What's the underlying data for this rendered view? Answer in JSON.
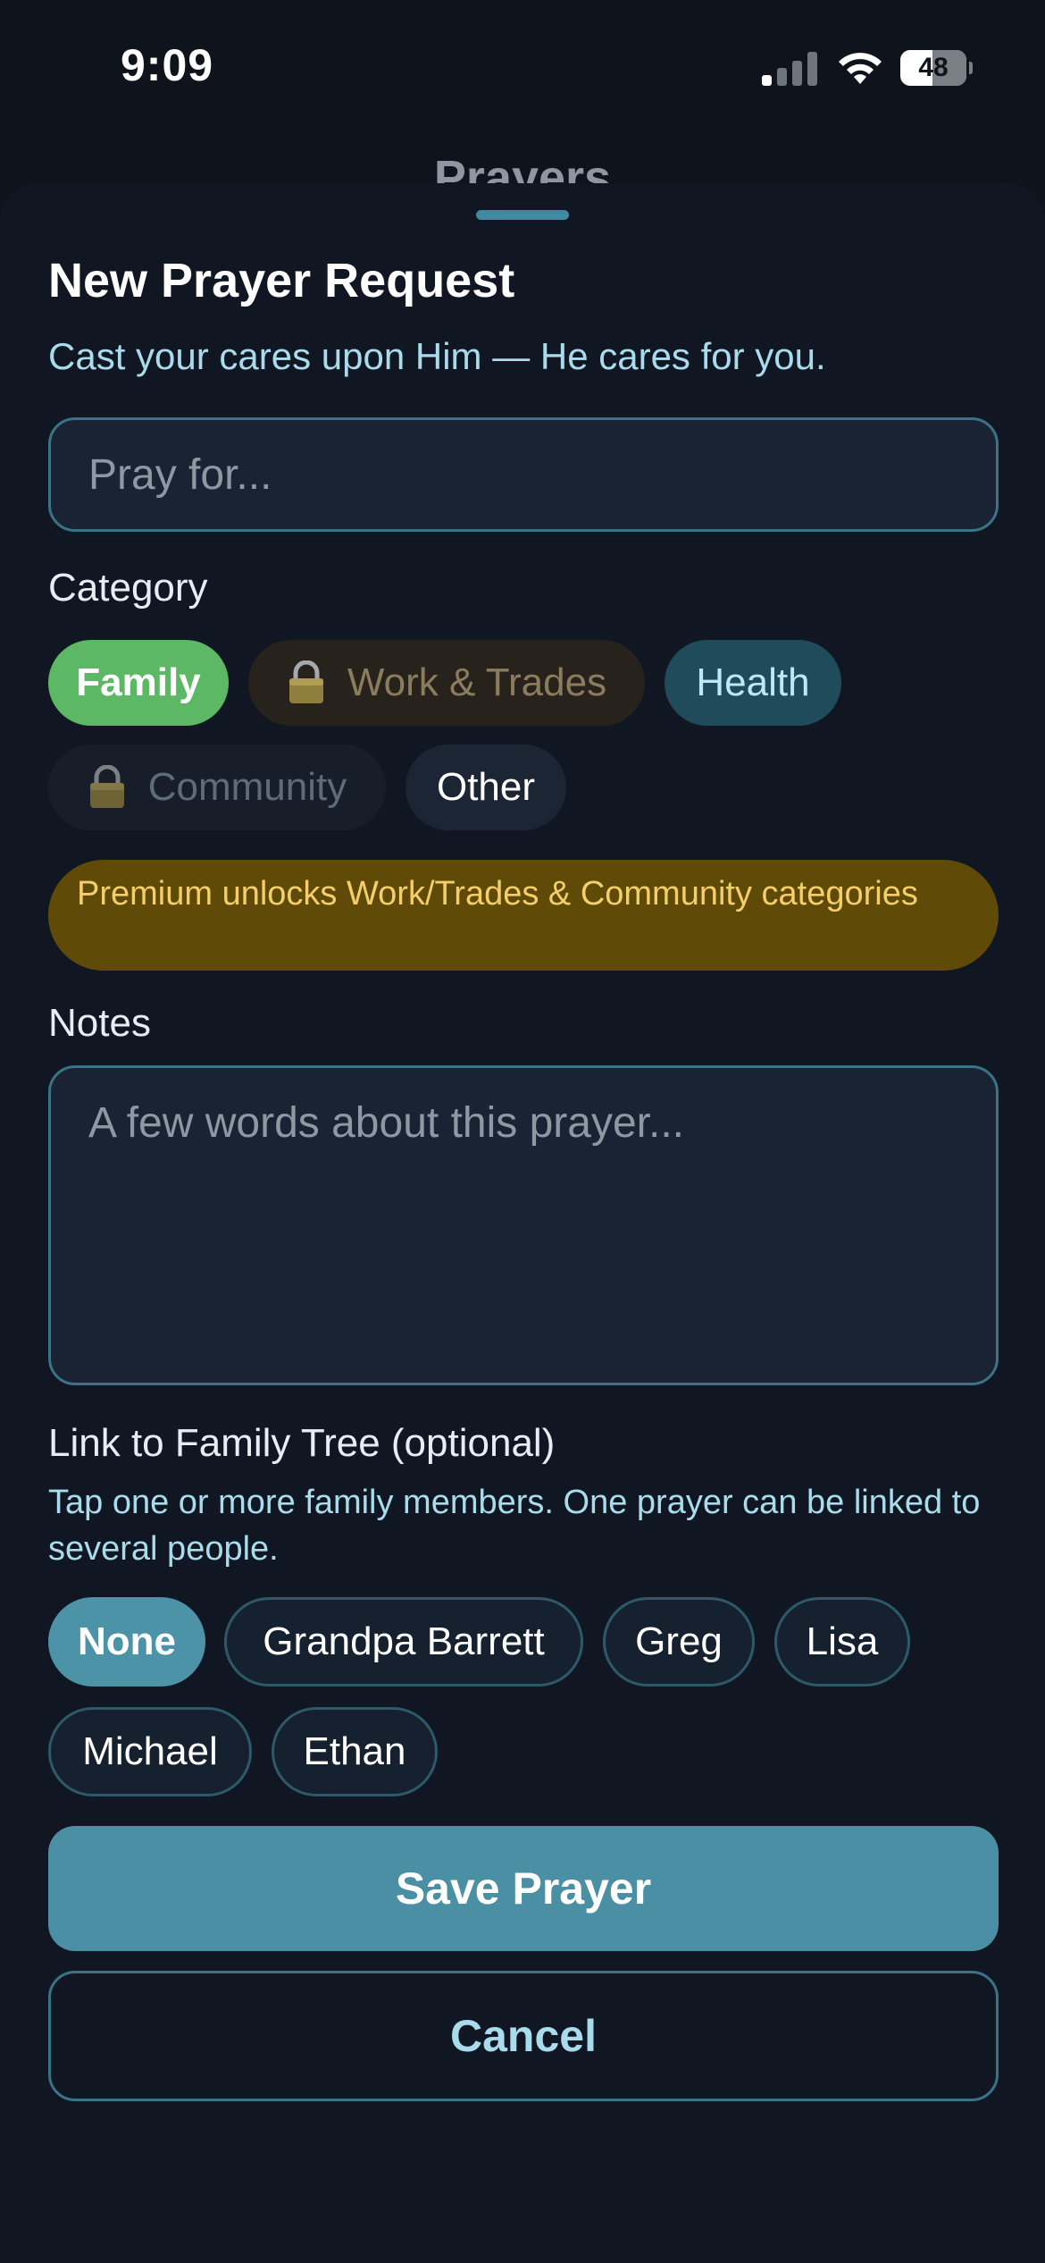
{
  "status_bar": {
    "time": "9:09",
    "battery_level": "48",
    "signal_icon": "cellular-signal-icon",
    "wifi_icon": "wifi-icon",
    "battery_icon": "battery-icon"
  },
  "background_page": {
    "title": "Prayers"
  },
  "sheet": {
    "title": "New Prayer Request",
    "subtitle": "Cast your cares upon Him — He cares for you.",
    "prayer_for": {
      "placeholder": "Pray for...",
      "value": ""
    },
    "category": {
      "label": "Category",
      "chips": [
        {
          "label": "Family",
          "selected": true,
          "locked": false
        },
        {
          "label": "Work & Trades",
          "selected": false,
          "locked": true
        },
        {
          "label": "Health",
          "selected": false,
          "locked": false
        },
        {
          "label": "Community",
          "selected": false,
          "locked": true
        },
        {
          "label": "Other",
          "selected": false,
          "locked": false
        }
      ],
      "lock_icon": "padlock-icon",
      "premium_notice": "Premium unlocks Work/Trades & Community categories"
    },
    "notes": {
      "label": "Notes",
      "placeholder": "A few words about this prayer...",
      "value": ""
    },
    "family_link": {
      "label": "Link to Family Tree (optional)",
      "helper": "Tap one or more family members. One prayer can be linked to several people.",
      "members": [
        {
          "label": "None",
          "selected": true
        },
        {
          "label": "Grandpa Barrett",
          "selected": false
        },
        {
          "label": "Greg",
          "selected": false
        },
        {
          "label": "Lisa",
          "selected": false
        },
        {
          "label": "Michael",
          "selected": false
        },
        {
          "label": "Ethan",
          "selected": false
        }
      ]
    },
    "save_label": "Save Prayer",
    "cancel_label": "Cancel"
  },
  "colors": {
    "background": "#0f141c",
    "sheet": "#111722",
    "accent": "#4a8fa3",
    "family_green": "#5cb865",
    "premium_banner": "#5f4a08",
    "premium_text": "#f3ce6b",
    "subtitle_text": "#a8dcec"
  }
}
